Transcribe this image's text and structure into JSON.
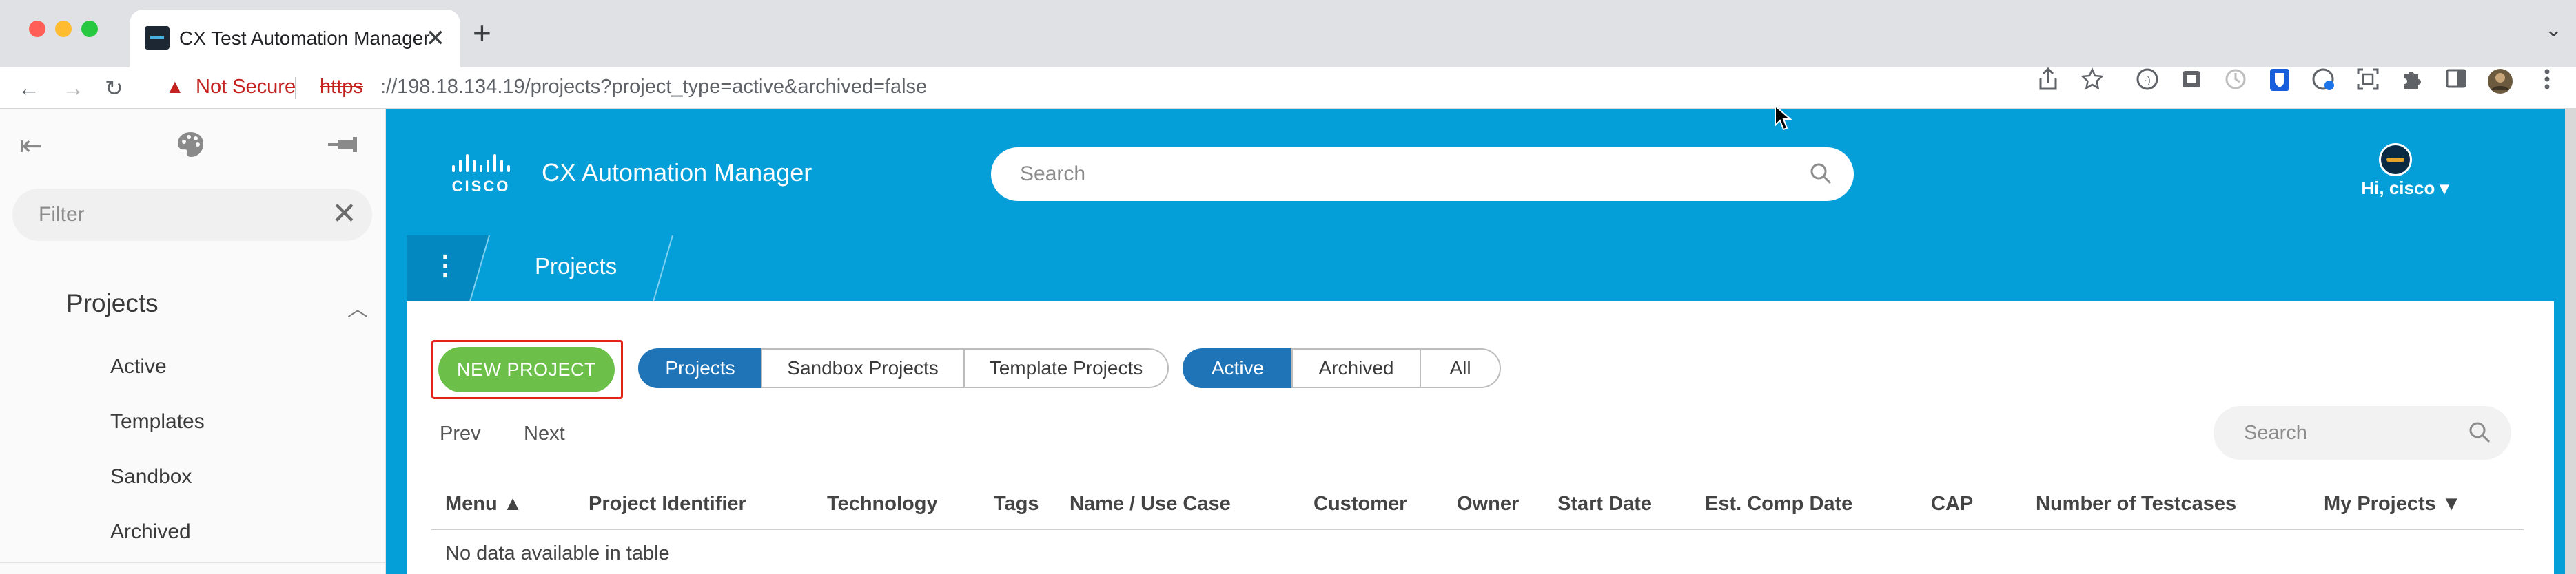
{
  "browser": {
    "tab_title": "CX Test Automation Manager",
    "tab_close": "✕",
    "new_tab": "+",
    "tab_menu": "⌄",
    "url_warning_icon": "▲",
    "url_security_label": "Not Secure",
    "url_scheme": "https",
    "url_rest": "://198.18.134.19/projects?project_type=active&archived=false",
    "nav_back": "←",
    "nav_forward": "→",
    "nav_reload": "↻",
    "toolbar_icons": [
      "share-icon",
      "bookmark-star-icon",
      "extension-icon-1",
      "extension-icon-2",
      "extension-icon-3",
      "bitwarden-icon",
      "extension-icon-4",
      "screenshot-icon",
      "puzzle-icon",
      "sidepanel-icon",
      "profile-avatar-icon",
      "kebab-menu-icon"
    ],
    "traffic_colors": [
      "#ff5f57",
      "#febc2e",
      "#28c840"
    ]
  },
  "sidebar": {
    "collapse_icon": "⇤",
    "palette_icon": "🎨",
    "pin_icon": "⊸",
    "filter_placeholder": "Filter",
    "filter_clear": "✕",
    "section_title": "Projects",
    "section_chevron": "︿",
    "items": [
      {
        "label": "Active"
      },
      {
        "label": "Templates"
      },
      {
        "label": "Sandbox"
      },
      {
        "label": "Archived"
      }
    ]
  },
  "app": {
    "brand_color": "#049fd9",
    "title": "CX Automation Manager",
    "search_placeholder": "Search",
    "user_greeting": "Hi, cisco ▾",
    "breadcrumb_menu": "⋮",
    "breadcrumb_label": "Projects"
  },
  "toolbar": {
    "new_project_label": "NEW PROJECT",
    "project_types": [
      {
        "label": "Projects",
        "active": true
      },
      {
        "label": "Sandbox Projects",
        "active": false
      },
      {
        "label": "Template Projects",
        "active": false
      }
    ],
    "status_filters": [
      {
        "label": "Active",
        "active": true
      },
      {
        "label": "Archived",
        "active": false
      },
      {
        "label": "All",
        "active": false
      }
    ],
    "prev_label": "Prev",
    "next_label": "Next",
    "table_search_placeholder": "Search"
  },
  "table": {
    "columns": [
      "Menu ▲",
      "Project Identifier",
      "Technology",
      "Tags",
      "Name / Use Case",
      "Customer",
      "Owner",
      "Start Date",
      "Est. Comp Date",
      "CAP",
      "Number of Testcases",
      "My Projects ▼"
    ],
    "empty_message": "No data available in table"
  }
}
